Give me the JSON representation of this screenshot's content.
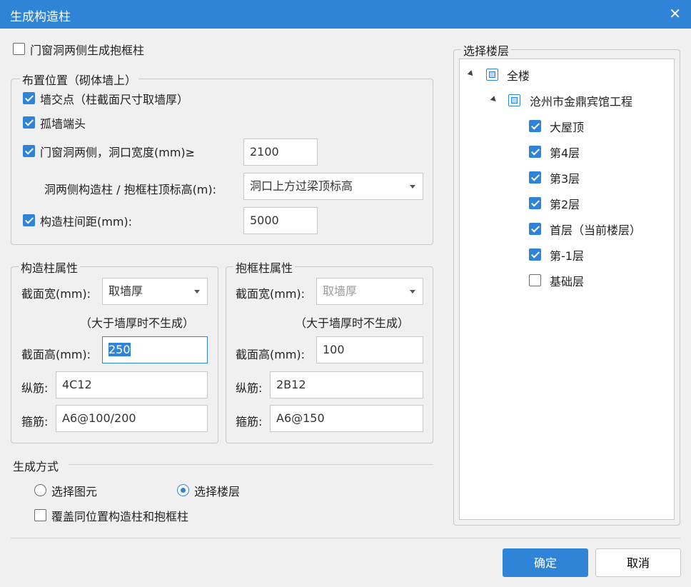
{
  "window": {
    "title": "生成构造柱",
    "close_glyph": "✕"
  },
  "top_checkbox": {
    "label": "门窗洞两侧生成抱框柱",
    "checked": false
  },
  "placement": {
    "title": "布置位置（砌体墙上）",
    "wall_intersection": {
      "label": "墙交点（柱截面尺寸取墙厚）",
      "checked": true
    },
    "isolated_wall_end": {
      "label": "孤墙端头",
      "checked": true
    },
    "opening_sides": {
      "label": "门窗洞两侧，洞口宽度(mm)≥",
      "checked": true,
      "value": "2100"
    },
    "top_elevation": {
      "label": "洞两侧构造柱 / 抱框柱顶标高(m):",
      "value": "洞口上方过梁顶标高"
    },
    "spacing": {
      "label": "构造柱间距(mm):",
      "checked": true,
      "value": "5000"
    }
  },
  "column_props": {
    "title": "构造柱属性",
    "width_label": "截面宽(mm):",
    "width_value": "取墙厚",
    "note": "（大于墙厚时不生成）",
    "height_label": "截面高(mm):",
    "height_value": "250",
    "long_bar_label": "纵筋:",
    "long_bar_value": "4C12",
    "stirrup_label": "箍筋:",
    "stirrup_value": "A6@100/200"
  },
  "frame_props": {
    "title": "抱框柱属性",
    "width_label": "截面宽(mm):",
    "width_value": "取墙厚",
    "note": "（大于墙厚时不生成）",
    "height_label": "截面高(mm):",
    "height_value": "100",
    "long_bar_label": "纵筋:",
    "long_bar_value": "2B12",
    "stirrup_label": "箍筋:",
    "stirrup_value": "A6@150"
  },
  "generate_mode": {
    "title": "生成方式",
    "option_elements": "选择图元",
    "option_floors": "选择楼层",
    "selected": "选择楼层",
    "overwrite": {
      "label": "覆盖同位置构造柱和抱框柱",
      "checked": false
    }
  },
  "floors": {
    "title": "选择楼层",
    "root": {
      "label": "全楼",
      "state": "partial"
    },
    "project": {
      "label": "沧州市金鼎宾馆工程",
      "state": "partial"
    },
    "items": [
      {
        "label": "大屋顶",
        "checked": true
      },
      {
        "label": "第4层",
        "checked": true
      },
      {
        "label": "第3层",
        "checked": true
      },
      {
        "label": "第2层",
        "checked": true
      },
      {
        "label": "首层（当前楼层）",
        "checked": true
      },
      {
        "label": "第-1层",
        "checked": true
      },
      {
        "label": "基础层",
        "checked": false
      }
    ]
  },
  "buttons": {
    "ok": "确定",
    "cancel": "取消"
  },
  "colors": {
    "accent": "#2f84d8",
    "background": "#f0f0f0"
  }
}
